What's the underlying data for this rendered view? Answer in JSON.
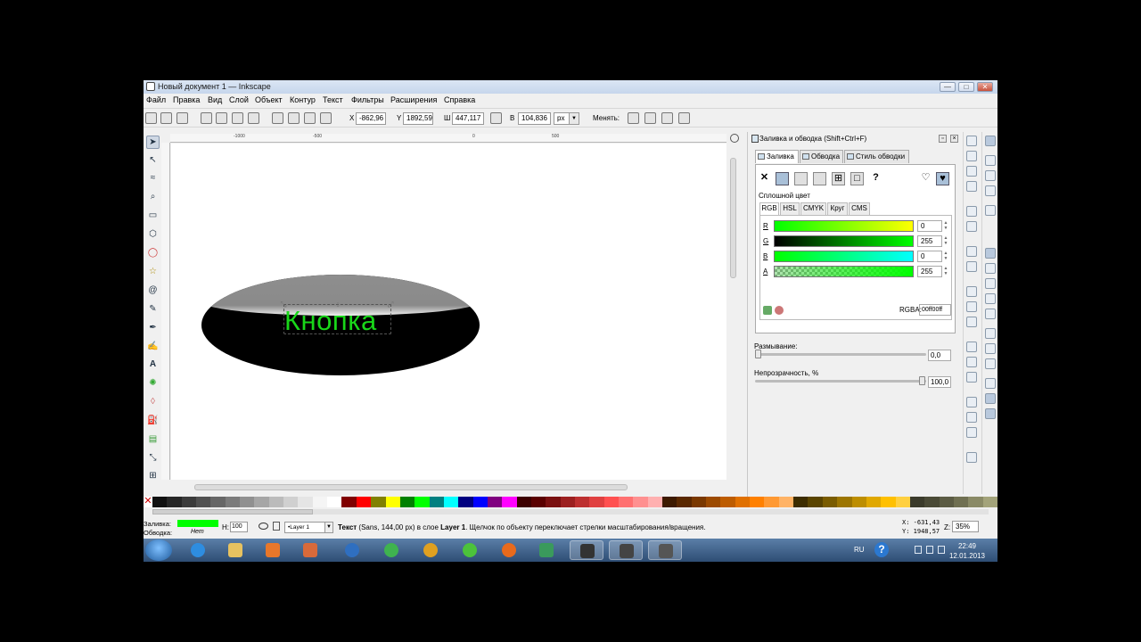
{
  "window": {
    "title": "Новый документ 1 — Inkscape",
    "buttons": {
      "minimize": "—",
      "maximize": "□",
      "close": "✕"
    }
  },
  "menu": [
    "Файл",
    "Правка",
    "Вид",
    "Слой",
    "Объект",
    "Контур",
    "Текст",
    "Фильтры",
    "Расширения",
    "Справка"
  ],
  "toolbar": {
    "x_label": "X",
    "x_value": "-862,96",
    "y_label": "Y",
    "y_value": "1892,59",
    "w_label": "Ш",
    "w_value": "447,117",
    "h_label": "В",
    "h_value": "104,836",
    "unit": "px",
    "transform_label": "Менять:"
  },
  "ruler": {
    "ticks": [
      "-1000",
      "-500",
      "0",
      "500"
    ]
  },
  "canvas": {
    "button_text": "Кнопка",
    "colors": {
      "text": "#19d719",
      "oval": "#000000",
      "highlight": "#8e8e8e"
    }
  },
  "dialog": {
    "title": "Заливка и обводка (Shift+Ctrl+F)",
    "tabs": [
      "Заливка",
      "Обводка",
      "Стиль обводки"
    ],
    "fill_type_label": "Сплошной цвет",
    "unset_symbol": "✕",
    "unknown_symbol": "?",
    "color_tabs": [
      "RGB",
      "HSL",
      "CMYK",
      "Круг",
      "CMS"
    ],
    "channels": [
      {
        "label": "R",
        "value": "0"
      },
      {
        "label": "G",
        "value": "255"
      },
      {
        "label": "B",
        "value": "0"
      },
      {
        "label": "A",
        "value": "255"
      }
    ],
    "rgba_label": "RGBA:",
    "rgba_value": "00ff00ff",
    "blur_label": "Размывание:",
    "blur_value": "0,0",
    "blur_level": 0.0,
    "opacity_label": "Непрозрачность, %",
    "opacity_value": "100,0",
    "opacity_level": 1.0
  },
  "palette": [
    "#111111",
    "#262626",
    "#3b3b3b",
    "#505050",
    "#666666",
    "#7b7b7b",
    "#909090",
    "#a6a6a6",
    "#bbbbbb",
    "#d0d0d0",
    "#e5e5e5",
    "#f5f5f5",
    "#ffffff",
    "#800000",
    "#ff0000",
    "#808000",
    "#ffff00",
    "#008000",
    "#00ff00",
    "#008080",
    "#00ffff",
    "#000080",
    "#0000ff",
    "#800080",
    "#ff00ff",
    "#3d0000",
    "#5a0000",
    "#7a1010",
    "#9c2020",
    "#bd3030",
    "#e04040",
    "#ff5050",
    "#ff7070",
    "#ff9090",
    "#ffb0b0",
    "#3d1a00",
    "#5a2800",
    "#7a3800",
    "#9c4a00",
    "#bd5c00",
    "#e07000",
    "#ff8000",
    "#ff9933",
    "#ffb366",
    "#3d2d00",
    "#5a4400",
    "#7a5c00",
    "#9c7500",
    "#bd8e00",
    "#e0a800",
    "#ffc000",
    "#ffd040",
    "#3b3b2b",
    "#4a4a36",
    "#5c5c44",
    "#707052",
    "#8a8a66",
    "#a3a37a"
  ],
  "status": {
    "fill_label": "Заливка:",
    "stroke_label": "Обводка:",
    "stroke_value": "Нет",
    "h_label": "Н:",
    "h_value": "100",
    "layer": "•Layer 1",
    "msg_prefix": "Текст",
    "msg_mid": " (Sans, 144,00 px) в слое ",
    "msg_layer": "Layer 1",
    "msg_suffix": ". Щелчок по объекту переключает стрелки масштабирования/вращения.",
    "x_coord": "X: -631,43",
    "y_coord": "Y: 1948,57",
    "z_label": "Z:",
    "zoom": "35%",
    "fill_color": "#00ff00"
  },
  "taskbar": {
    "lang": "RU",
    "time": "22:49",
    "date": "12.01.2013"
  }
}
